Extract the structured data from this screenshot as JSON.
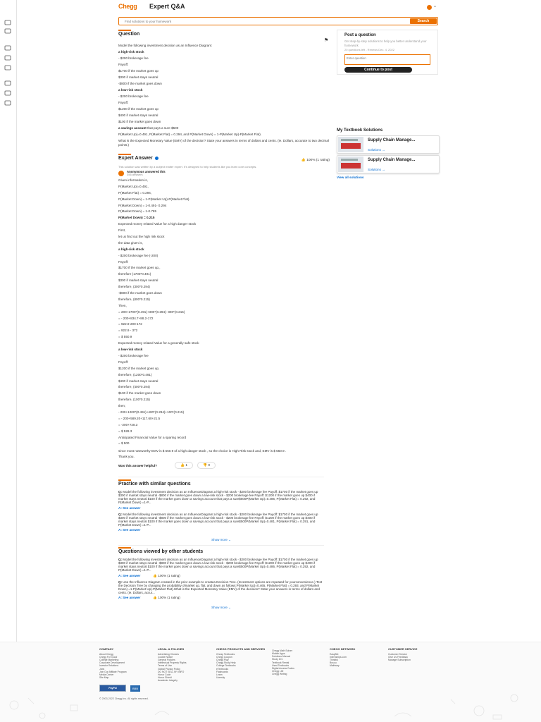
{
  "brand": {
    "logo": "Chegg",
    "page_title": "Expert Q&A",
    "accent": "#eb7100",
    "link": "#0a6ed1"
  },
  "search": {
    "placeholder": "Find solutions to your homework",
    "button": "Search"
  },
  "rail_icons": [
    "home-icon",
    "grid-icon",
    "book-icon",
    "layers-icon",
    "flashcard-icon",
    "card-icon",
    "bulb-icon",
    "calculator-icon"
  ],
  "question": {
    "heading": "Question",
    "lines": [
      {
        "t": "Model the following investment decision as an Influence Diagram:",
        "b": false
      },
      {
        "t": "a high-risk stock",
        "b": true
      },
      {
        "t": "- $200 brokerage fee",
        "b": false
      },
      {
        "t": "Payoff:",
        "b": false
      },
      {
        "t": "$1700 if the market goes up",
        "b": false
      },
      {
        "t": "$300 if market stays neutral",
        "b": false
      },
      {
        "t": "-$800 if the market goes down",
        "b": false
      },
      {
        "t": "a low-risk stock",
        "b": true
      },
      {
        "t": "- $200 brokerage fee",
        "b": false
      },
      {
        "t": "Payoff:",
        "b": false
      },
      {
        "t": "$1200 if the market goes up",
        "b": false
      },
      {
        "t": "$400 if market stays neutral",
        "b": false
      },
      {
        "t": "$100 if the market goes down",
        "b": false
      }
    ],
    "savings_bold": "a savings account",
    "savings_rest": " that pays a sure $500",
    "probabilities": "P(Market Up)=0.491, P(Market Flat) = 0.294, and P(Market Down) = 1-P(Market Up)-P(Market Flat).",
    "ask": "What is the Expected Monetary Value (EMV) of the decision? State your answers in terms of dollars and cents. (ie. Dollars, accurate to two decimal points.)"
  },
  "answer": {
    "heading": "Expert Answer",
    "rating": "100% (1 rating)",
    "subtitle": "This solution was written by a subject matter expert. It's designed to help students like you learn core concepts.",
    "author": "Anonymous answered this",
    "author_count": "356 answers",
    "lines": [
      {
        "t": "Given information is,",
        "b": false
      },
      {
        "t": "P(Market Up)=0.491,",
        "b": false
      },
      {
        "t": "P(Market Flat) = 0.294,",
        "b": false
      },
      {
        "t": "P(Market Down) = 1-P(Market Up)-P(Market Flat).",
        "b": false
      },
      {
        "t": "P(Market Down) = 1-0.491- 0.294",
        "b": false
      },
      {
        "t": "P(Market Down) = 1-0.785",
        "b": false
      },
      {
        "t": "P(Market Down) = 0.215",
        "b": true
      },
      {
        "t": "Expected money related Value for a high danger stock",
        "b": false
      },
      {
        "t": "First,",
        "b": false
      },
      {
        "t": "let us find out the high risk stock",
        "b": false
      },
      {
        "t": "the data given is,",
        "b": false
      },
      {
        "t": "a high-risk stock",
        "b": true
      },
      {
        "t": "- $200 brokerage fee (-200)",
        "b": false
      },
      {
        "t": "Payoff:",
        "b": false
      },
      {
        "t": "$1700 if the market goes up,,",
        "b": false
      },
      {
        "t": "therefore (1700*0.491)",
        "b": false
      },
      {
        "t": "$300 if market stays neutral",
        "b": false
      },
      {
        "t": "therefore, (300*0.294)",
        "b": false
      },
      {
        "t": "-$800 if the market goes down",
        "b": false
      },
      {
        "t": "therefore, (800*0.215)",
        "b": false
      },
      {
        "t": "Then,",
        "b": false
      },
      {
        "t": "= 200+1700*(0.491)+300*(0.294)- 800*(0.215)",
        "b": false
      },
      {
        "t": "= - 200+834.7+88.2-172",
        "b": false
      },
      {
        "t": "= 922.9-200-172",
        "b": false
      },
      {
        "t": "= 922.9 - 372",
        "b": false
      },
      {
        "t": "= $ 550.9",
        "b": false
      },
      {
        "t": "Expected money related Value for a generally safe stock",
        "b": false
      },
      {
        "t": "a low-risk stock",
        "b": true
      },
      {
        "t": "- $200 brokerage fee",
        "b": false
      },
      {
        "t": "Payoff:",
        "b": false
      },
      {
        "t": "$1200 if the market goes up,",
        "b": false
      },
      {
        "t": "therefore, (1200*0.491)",
        "b": false
      },
      {
        "t": "$400 if market stays neutral",
        "b": false
      },
      {
        "t": "therefore, (400*0.294)",
        "b": false
      },
      {
        "t": "$100 if the market goes down",
        "b": false
      },
      {
        "t": "therefore, (100*0.215)",
        "b": false
      },
      {
        "t": "then;",
        "b": false
      },
      {
        "t": "- 200+1200*(0.491)+400*(0.294)+100*(0.215)",
        "b": false
      },
      {
        "t": "= - 200+589.20+117.60+21.5",
        "b": false
      },
      {
        "t": "= -200+728.3",
        "b": false
      },
      {
        "t": "= $ 528.3",
        "b": false
      },
      {
        "t": "Anticipated Financial Value for a sparing record",
        "b": false
      },
      {
        "t": "= $ 500",
        "b": false
      }
    ],
    "conclusion": "since most noteworthy EMV is $ 550.9 of a high danger stock , so the choice is High Risk stock and, EMV is $ 550.9 .",
    "thanks": "Thank you.",
    "helpful_label": "Was this answer helpful?",
    "thumbs_up": "1",
    "thumbs_down": "0"
  },
  "sidebar": {
    "post_title": "Post a question",
    "post_desc": "Get step-by-step solutions to help you better understand your homework",
    "post_left": "20 questions left - Renews Dec. 4, 2022",
    "post_placeholder": "Enter question",
    "post_button": "Continue to post",
    "textbook_heading": "My Textbook Solutions",
    "textbooks": [
      {
        "title": "Supply Chain Manage...",
        "link": "Solutions →"
      },
      {
        "title": "Supply Chain Manage...",
        "link": "Solutions →"
      }
    ],
    "view_all": "View all solutions"
  },
  "practice": {
    "heading": "Practice with similar questions",
    "items": [
      {
        "q": "Q:",
        "text": "Model the following investment decision as an InfluenceDiagram:a high-risk stock - $200 brokerage fee Payoff: $1700 if the market goes up $300 if market stays neutral -$800 if the market goes down a low-risk stock - $200 brokerage fee Payoff: $1200 if the market goes up $400 if market stays neutral $100 if the market goes down a savings account that pays a sure$500P(Market Up)=0.486, P(Market Flat) = 0.292, and P(Market Down) =1-P...",
        "see": "A: See answer"
      },
      {
        "q": "Q:",
        "text": "Model the following investment decision as an InfluenceDiagram:a high-risk stock - $200 brokerage fee Payoff: $1700 if the market goes up $300 if market stays neutral -$800 if the market goes down a low-risk stock - $200 brokerage fee Payoff: $1200 if the market goes up $400 if market stays neutral $100 if the market goes down a savings account that pays a sure$500P(Market Up)=0.481, P(Market Flat) = 0.291, and P(Market Down) =1-P...",
        "see": "A: See answer"
      }
    ],
    "show_more": "Show more ⌄"
  },
  "viewed": {
    "heading": "Questions viewed by other students",
    "items": [
      {
        "q": "Q:",
        "text": "Model the following investment decision as an InfluenceDiagram:a high-risk stock - $200 brokerage fee Payoff: $1700 if the market goes up $300 if market stays neutral -$800 if the market goes down a low-risk stock - $200 brokerage fee Payoff: $1200 if the market goes up $400 if market stays neutral $100 if the market goes down a savings account that pays a sure$500P(Market Up)=0.486, P(Market Flat) = 0.292, and P(Market Down) =1-P...",
        "see": "A: See answer",
        "rating": "100% (1 rating)"
      },
      {
        "q": "Q:",
        "text": "Use the Influence Diagram created in the prior example to createa Decision Tree. (Investment options are repeated for yourconvenience.) Test the Decision Tree by changing the probability ofmarket up, flat, and down as follows:P(Market Up)=0.465, P(Market Flat) = 0.293, and P(Market Down) =1-P(Market Up)-P(Market Flat).What is the Expected Monetary Value (EMV) of the decision? State your answers in terms of dollars and cents. (ie. Dollars, accur...",
        "see": "A: See answer",
        "rating": "100% (1 rating)"
      }
    ],
    "show_more": "Show more ⌄"
  },
  "footer": {
    "columns": [
      {
        "head": "COMPANY",
        "links": [
          "About Chegg",
          "Chegg For Good",
          "College Marketing",
          "Corporate Development",
          "Investor Relations",
          "Jobs",
          "Join Our Affiliate Program",
          "Media Center",
          "Site Map"
        ]
      },
      {
        "head": "LEGAL & POLICIES",
        "links": [
          "Advertising Choices",
          "Cookie Notice",
          "General Policies",
          "Intellectual Property Rights",
          "Terms of Use",
          "Global Privacy Policy",
          "DO NOT SELL MY INFO",
          "Honor Code",
          "Honor Shield",
          "Academic Integrity"
        ]
      },
      {
        "head": "CHEGG PRODUCTS AND SERVICES",
        "links": [
          "Cheap Textbooks",
          "Chegg Coupon",
          "Chegg Play",
          "Chegg Study Help",
          "College Textbooks",
          "eTextbooks",
          "Flashcards",
          "Learn",
          "Uversity"
        ]
      },
      {
        "head": "",
        "links": [
          "Chegg Math Solver",
          "Mobile Apps",
          "Solutions Manual",
          "Study 101",
          "Textbook Rental",
          "Used Textbooks",
          "Digital Access Codes",
          "Chegg Life",
          "Chegg Writing"
        ]
      },
      {
        "head": "CHEGG NETWORK",
        "links": [
          "EasyBib",
          "Internships.com",
          "Thinkful",
          "Busuu",
          "Mathway"
        ]
      },
      {
        "head": "CUSTOMER SERVICE",
        "links": [
          "Customer Service",
          "Give Us Feedback",
          "Manage Subscription"
        ]
      }
    ],
    "badge1": "PayPal",
    "badge2": "BBB",
    "copyright": "© 2003-2022 Chegg Inc. All rights reserved."
  }
}
